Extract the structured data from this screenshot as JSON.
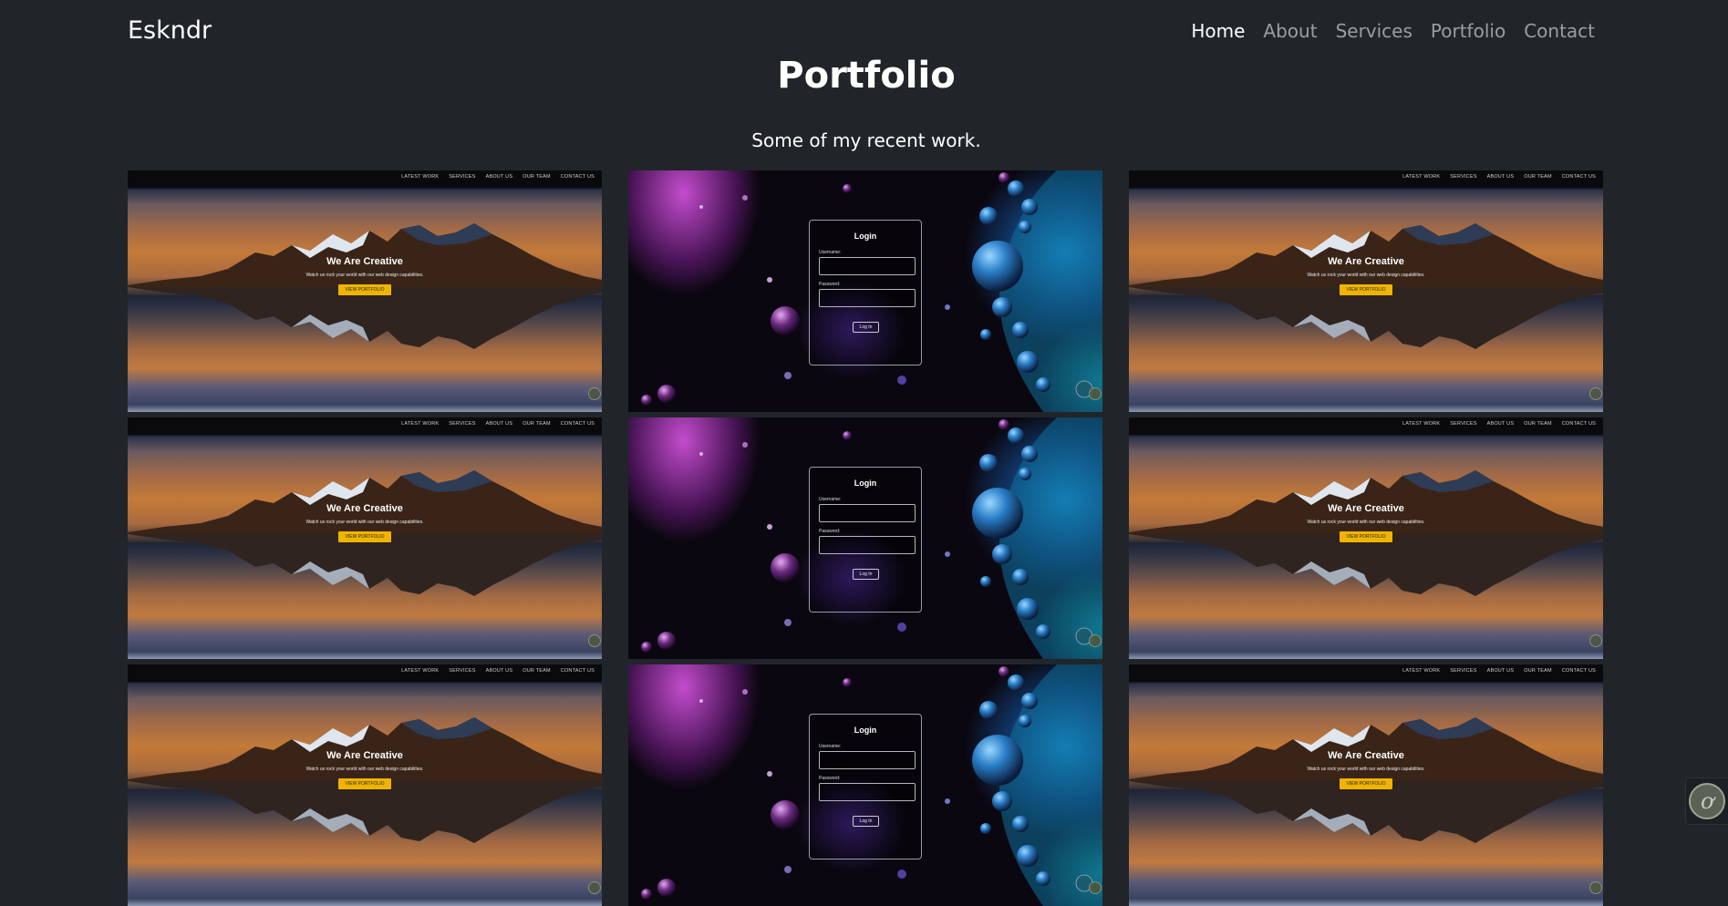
{
  "navbar": {
    "brand": "Eskndr",
    "links": [
      {
        "label": "Home",
        "active": true
      },
      {
        "label": "About",
        "active": false
      },
      {
        "label": "Services",
        "active": false
      },
      {
        "label": "Portfolio",
        "active": false
      },
      {
        "label": "Contact",
        "active": false
      }
    ]
  },
  "portfolio": {
    "title": "Portfolio",
    "subtitle": "Some of my recent work."
  },
  "thumbs": {
    "creative": {
      "nav": [
        "LATEST WORK",
        "SERVICES",
        "ABOUT US",
        "OUR TEAM",
        "CONTACT US"
      ],
      "heading": "We Are Creative",
      "tagline": "Watch us rock your world with our web design capabilities.",
      "button": "VIEW PORTFOLIO"
    },
    "login": {
      "heading": "Login",
      "username_label": "Username:",
      "password_label": "Password:",
      "button": "Log In"
    }
  },
  "grid_layout": [
    "creative",
    "login",
    "creative",
    "creative",
    "login",
    "creative",
    "creative",
    "login",
    "creative"
  ],
  "widget": {
    "icon": "chat-widget-icon",
    "glyph": "ơ"
  },
  "colors": {
    "background": "#212529",
    "nav_inactive": "rgba(255,255,255,0.55)",
    "accent_button": "#f0b400"
  }
}
